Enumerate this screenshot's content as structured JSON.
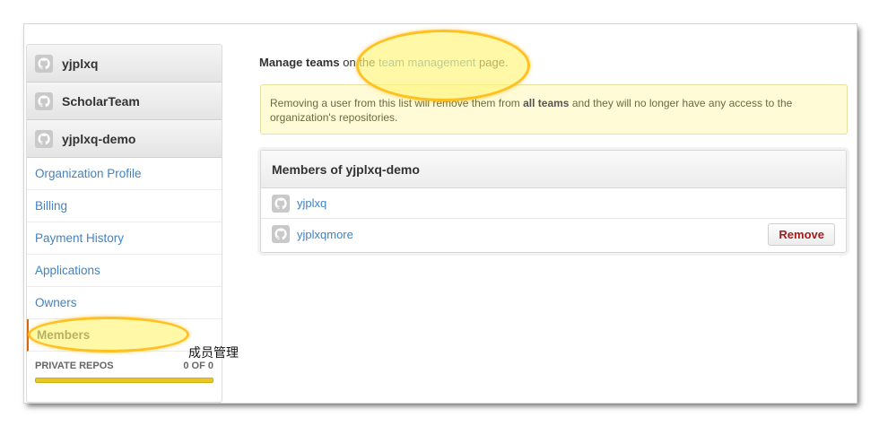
{
  "sidebar": {
    "accounts": [
      {
        "name": "yjplxq"
      },
      {
        "name": "ScholarTeam"
      },
      {
        "name": "yjplxq-demo"
      }
    ],
    "nav": [
      {
        "label": "Organization Profile"
      },
      {
        "label": "Billing"
      },
      {
        "label": "Payment History"
      },
      {
        "label": "Applications"
      },
      {
        "label": "Owners"
      },
      {
        "label": "Members",
        "selected": true
      }
    ],
    "private_repos": {
      "label": "PRIVATE REPOS",
      "count": "0 OF 0"
    }
  },
  "main": {
    "manage_prefix": "Manage teams",
    "manage_mid": "on the",
    "manage_link": "team management",
    "manage_suffix": "page.",
    "flash_part1": "Removing a user from this list will remove them from",
    "flash_bold": "all teams",
    "flash_part2": "and they will no longer have any access to the organization's repositories.",
    "members_title": "Members of yjplxq-demo",
    "members": [
      {
        "name": "yjplxq",
        "removable": false
      },
      {
        "name": "yjplxqmore",
        "removable": true
      }
    ],
    "remove_label": "Remove"
  },
  "annotation": "成员管理",
  "colors": {
    "link": "#4183c4",
    "highlight": "#fff578",
    "highlight_border": "#ffb914",
    "selected_border": "#d26911"
  }
}
